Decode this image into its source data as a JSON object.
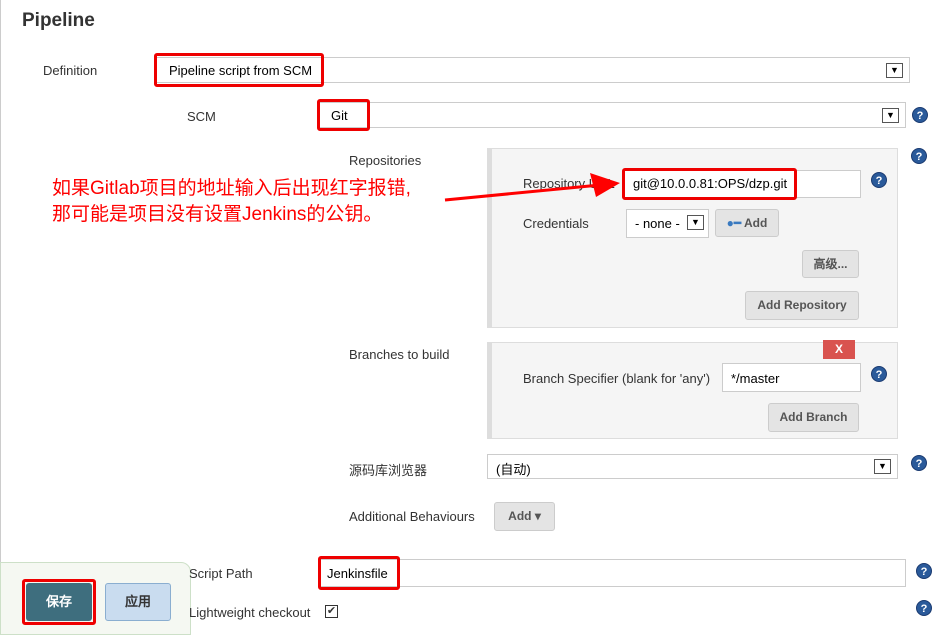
{
  "section_title": "Pipeline",
  "definition": {
    "label": "Definition",
    "value": "Pipeline script from SCM"
  },
  "scm": {
    "label": "SCM",
    "value": "Git"
  },
  "repositories": {
    "label": "Repositories",
    "url_label": "Repository URL",
    "url_value": "git@10.0.0.81:OPS/dzp.git",
    "credentials_label": "Credentials",
    "credentials_value": "- none -",
    "add_label": "Add",
    "advanced_label": "高级...",
    "add_repository_label": "Add Repository"
  },
  "branches": {
    "label": "Branches to build",
    "delete_label": "X",
    "specifier_label": "Branch Specifier (blank for 'any')",
    "specifier_value": "*/master",
    "add_branch_label": "Add Branch"
  },
  "browser": {
    "label": "源码库浏览器",
    "value": "(自动)"
  },
  "behaviours": {
    "label": "Additional Behaviours",
    "add_label": "Add"
  },
  "script_path": {
    "label": "Script Path",
    "value": "Jenkinsfile"
  },
  "lightweight": {
    "label": "Lightweight checkout",
    "checked": true
  },
  "annotation": {
    "line1": "如果Gitlab项目的地址输入后出现红字报错,",
    "line2": "那可能是项目没有设置Jenkins的公钥。",
    "color": "#ff0000"
  },
  "footer": {
    "save_label": "保存",
    "apply_label": "应用"
  }
}
